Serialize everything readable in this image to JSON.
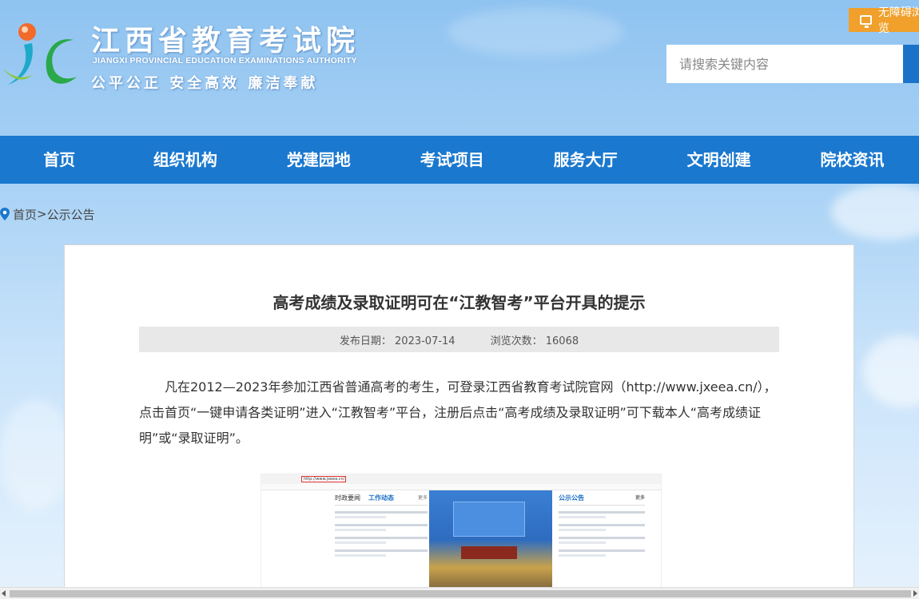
{
  "header": {
    "site_name": "江西省教育考试院",
    "site_name_en": "JIANGXI PROVINCIAL EDUCATION EXAMINATIONS AUTHORITY",
    "slogan": "公平公正  安全高效  廉洁奉献",
    "accessibility_label": "无障碍浏览",
    "search_placeholder": "请搜索关键内容"
  },
  "nav": {
    "items": [
      "首页",
      "组织机构",
      "党建园地",
      "考试项目",
      "服务大厅",
      "文明创建",
      "院校资讯"
    ]
  },
  "breadcrumb": {
    "home": "首页",
    "separator": ">",
    "current": "公示公告"
  },
  "article": {
    "title": "高考成绩及录取证明可在“江教智考”平台开具的提示",
    "publish_date_label": "发布日期：",
    "publish_date": "2023-07-14",
    "views_label": "浏览次数：",
    "views": "16068",
    "body": "凡在2012—2023年参加江西省普通高考的考生，可登录江西省教育考试院官网（http://www.jxeea.cn/），点击首页“一键申请各类证明”进入“江教智考”平台，注册后点击“高考成绩及录取证明”可下载本人“高考成绩证明”或“录取证明”。"
  },
  "embedded_screenshot": {
    "url": "http://www.jxeea.cn/",
    "tab_politics": "时政要闻",
    "tab_work": "工作动态",
    "more": "更多",
    "notice_header": "公示公告"
  },
  "colors": {
    "nav_bg": "#1a78cf",
    "access_btn": "#f0a02b",
    "meta_bg": "#e8e8e8"
  }
}
